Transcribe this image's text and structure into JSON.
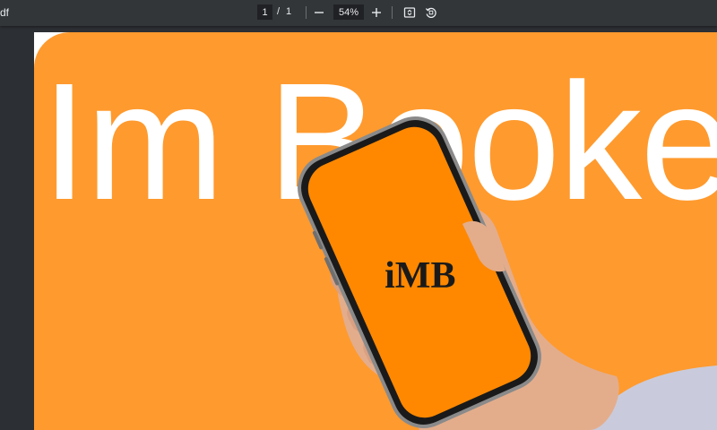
{
  "toolbar": {
    "doc_title_fragment": "df",
    "current_page": "1",
    "page_separator": "/",
    "total_pages": "1",
    "zoom": "54%",
    "icons": {
      "zoom_out": "minus-icon",
      "zoom_in": "plus-icon",
      "fit": "fit-to-page-icon",
      "rotate": "rotate-icon"
    }
  },
  "page": {
    "headline": "Im Booke",
    "logo": "iMB",
    "colors": {
      "panel": "#ff9a2e",
      "screen": "#ff8800",
      "headline": "#ffffff"
    }
  }
}
